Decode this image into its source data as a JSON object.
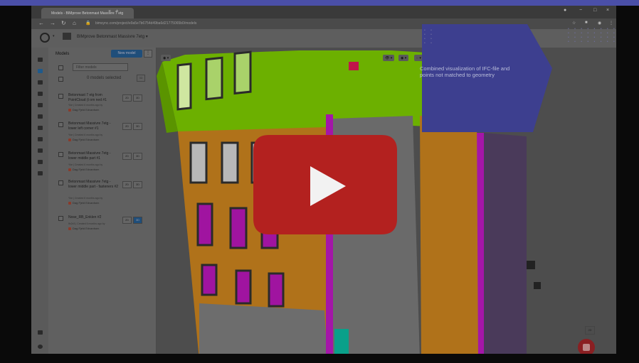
{
  "browser": {
    "tab_title": "Models - BIMprove Betonmast Massivre 7 etg",
    "url": "bimsync.com/project/e9a5e7b6754d49ba6d21775065b0/models",
    "new_tab_glyph": "+",
    "tab_close_glyph": "×",
    "window_controls": [
      "●",
      "−",
      "□",
      "×"
    ]
  },
  "app": {
    "project_name": "BIMprove Betonmast Massivre 7etg ▾"
  },
  "panel": {
    "title": "Models",
    "new_model_label": "New model",
    "more_label": "⋮",
    "filter_placeholder": "Filter models",
    "selected_text": "0 models selected",
    "selected_3d": "3D"
  },
  "models": [
    {
      "name": "Betonmast 7 etg from PointCloud (t om ned #1",
      "meta": "Yke | Created 6 months ago by",
      "user": "Dag Fjeld Edvardsen",
      "btn2d": "2D",
      "btn3d": "3D",
      "active3d": false
    },
    {
      "name": "Betonmast Massivre 7etg - lower left corner #1",
      "meta": "Yke | Created 6 months ago by",
      "user": "Dag Fjeld Edvardsen",
      "btn2d": "2D",
      "btn3d": "3D",
      "active3d": false
    },
    {
      "name": "Betonmast Massivre 7etg - lower middle part #1",
      "meta": "Yke | Created 6 months ago by",
      "user": "Dag Fjeld Edvardsen",
      "btn2d": "2D",
      "btn3d": "3D",
      "active3d": false
    },
    {
      "name": "Betonmast Massivre 7etg - lower middle part - fasteners #2",
      "meta": "Yke | Created 6 months ago by",
      "user": "Dag Fjeld Edvardsen",
      "btn2d": "2D",
      "btn3d": "3D",
      "active3d": false
    },
    {
      "name": "Nose_RB_Enklen #2",
      "meta": "Ifc2x3 | Created 6 months ago by",
      "user": "Dag Fjeld Edvardsen",
      "btn2d": "2D",
      "btn3d": "3D",
      "active3d": true
    }
  ],
  "viewer": {
    "eye_tool": "👁 ▾",
    "tool2": "◉ ▾",
    "tool3": "◌ ▾",
    "settings_tool": "⚙ ▾",
    "mode_tool": "◉ ▾",
    "corner_label": "2D",
    "card_text": "Combined visualization of IFC-file and points not matched to geometry"
  },
  "colors": {
    "card": "#3d3f8f",
    "play": "#b3211f",
    "lime": "#7fd400",
    "orange": "#d98a1a",
    "magenta": "#e61bd6"
  }
}
